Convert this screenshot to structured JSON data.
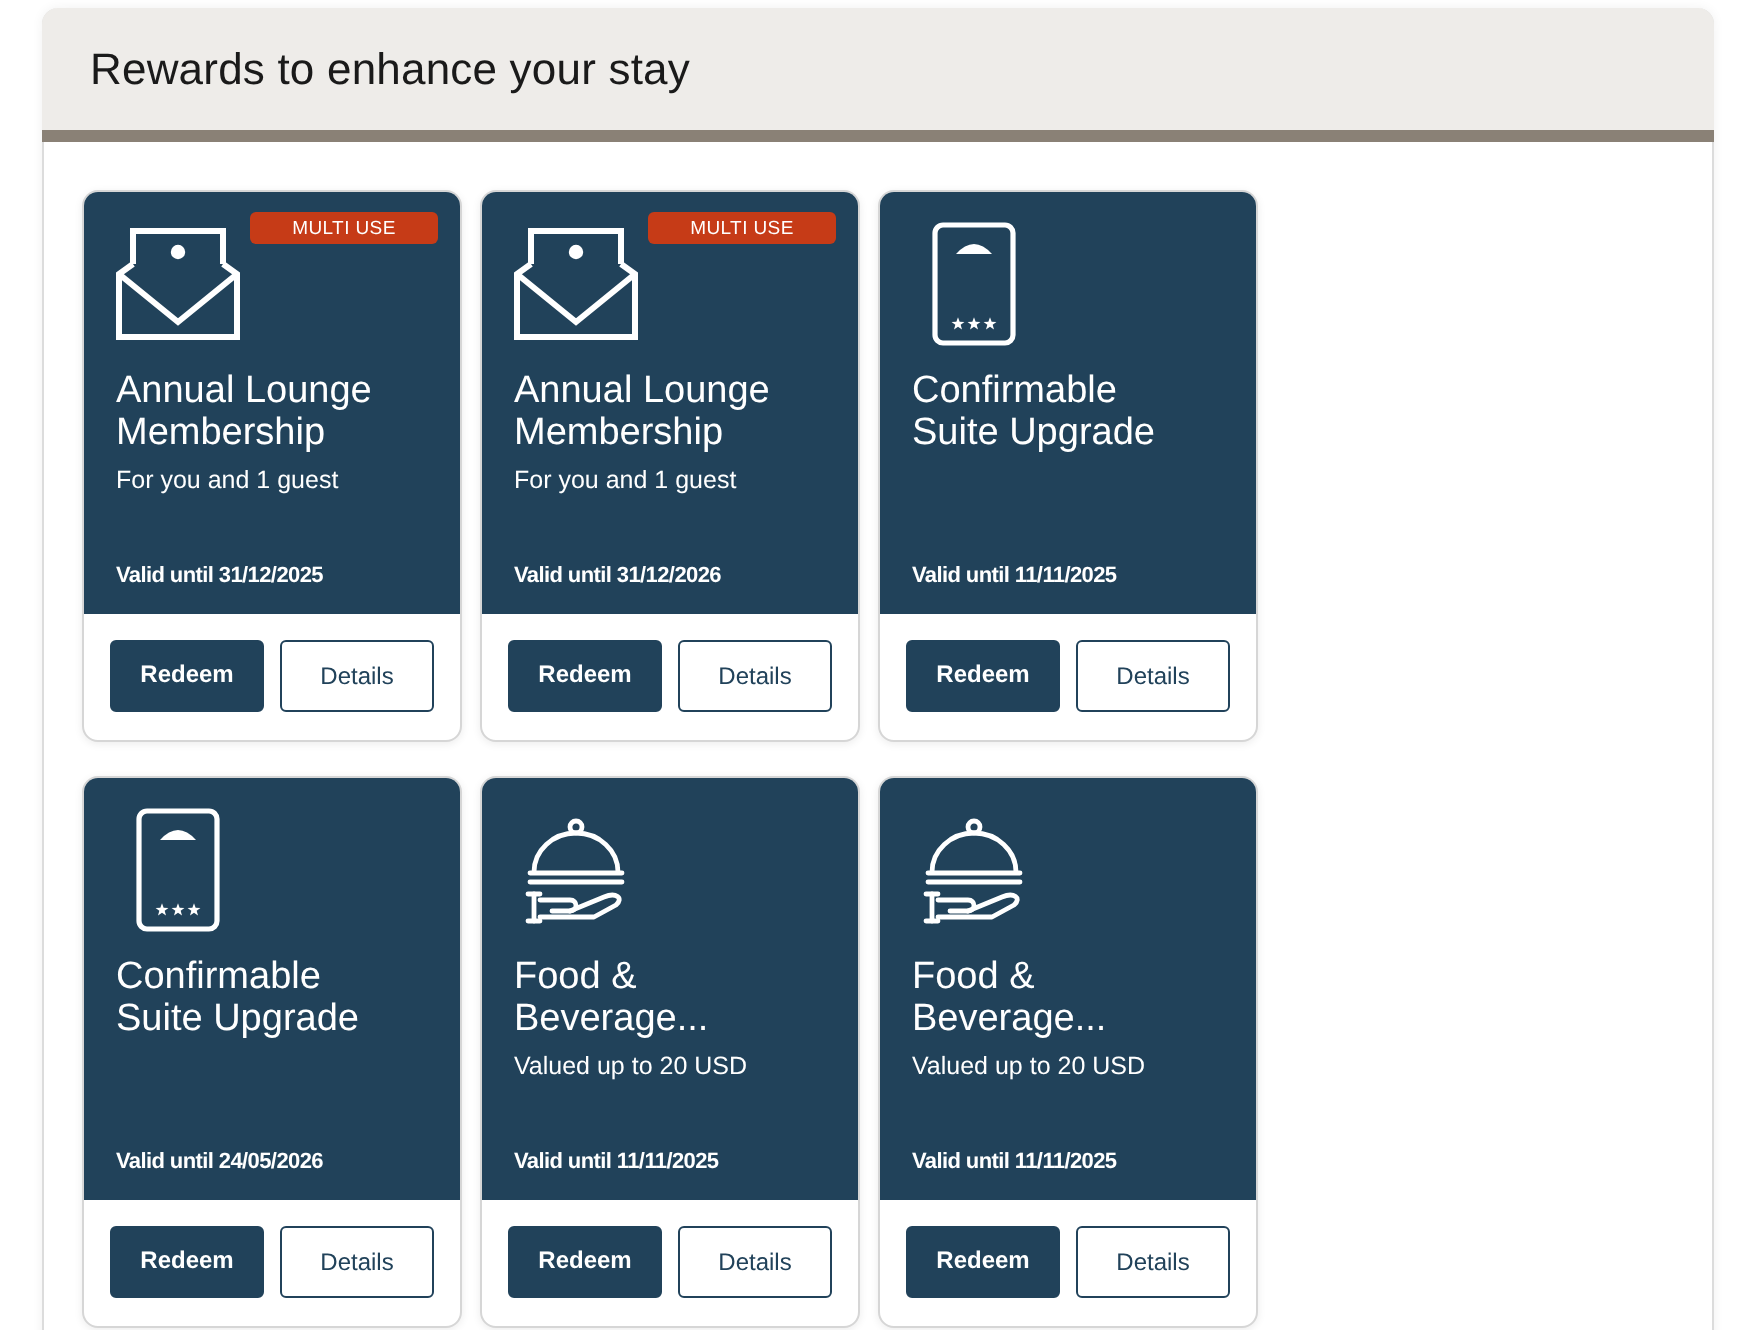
{
  "section": {
    "title": "Rewards to enhance your stay"
  },
  "rewards": [
    {
      "kind": "lounge",
      "badge": "MULTI USE",
      "title": "Annual Lounge Membership",
      "subtitle": "For you and 1 guest",
      "validity": "Valid until 31/12/2025",
      "actions": [
        {
          "kind": "primary",
          "label": "Redeem"
        },
        {
          "kind": "secondary",
          "label": "Details"
        }
      ]
    },
    {
      "kind": "lounge",
      "badge": "MULTI USE",
      "title": "Annual Lounge Membership",
      "subtitle": "For you and 1 guest",
      "validity": "Valid until 31/12/2026",
      "actions": [
        {
          "kind": "primary",
          "label": "Redeem"
        },
        {
          "kind": "secondary",
          "label": "Details"
        }
      ]
    },
    {
      "kind": "suite",
      "title": "Confirmable Suite Upgrade",
      "validity": "Valid until 11/11/2025",
      "actions": [
        {
          "kind": "primary",
          "label": "Redeem"
        },
        {
          "kind": "secondary",
          "label": "Details"
        }
      ]
    },
    {
      "kind": "suite",
      "title": "Confirmable Suite Upgrade",
      "validity": "Valid until 24/05/2026",
      "actions": [
        {
          "kind": "primary",
          "label": "Redeem"
        },
        {
          "kind": "secondary",
          "label": "Details"
        }
      ]
    },
    {
      "kind": "food",
      "title": "Food & Beverage...",
      "subtitle": "Valued up to 20 USD",
      "validity": "Valid until 11/11/2025",
      "actions": [
        {
          "kind": "primary",
          "label": "Redeem"
        },
        {
          "kind": "secondary",
          "label": "Details"
        }
      ]
    },
    {
      "kind": "food",
      "title": "Food & Beverage...",
      "subtitle": "Valued up to 20 USD",
      "validity": "Valid until 11/11/2025",
      "actions": [
        {
          "kind": "primary",
          "label": "Redeem"
        },
        {
          "kind": "secondary",
          "label": "Details"
        }
      ]
    }
  ]
}
